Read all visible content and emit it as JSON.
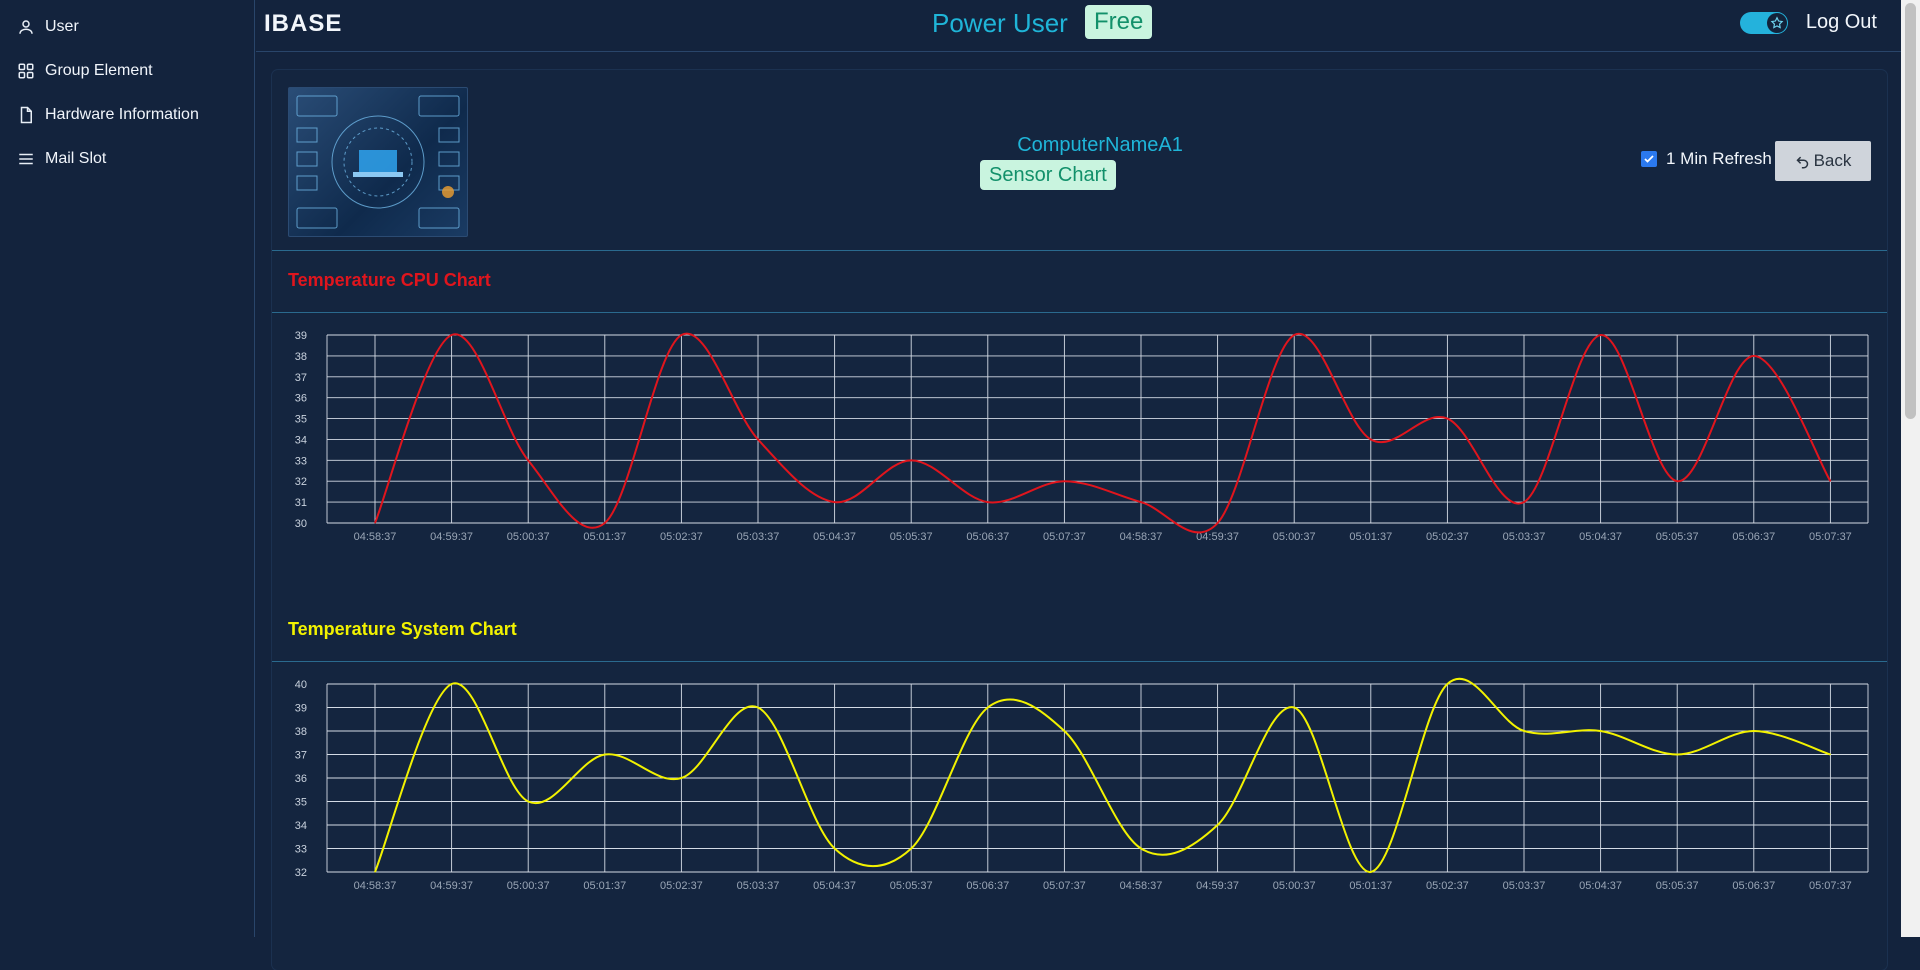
{
  "sidebar": {
    "items": [
      {
        "label": "User",
        "icon": "user-icon"
      },
      {
        "label": "Group Element",
        "icon": "grid-icon"
      },
      {
        "label": "Hardware Information",
        "icon": "document-icon"
      },
      {
        "label": "Mail Slot",
        "icon": "menu-icon"
      }
    ]
  },
  "header": {
    "brand": "IBASE",
    "role": "Power User",
    "plan_badge": "Free",
    "logout_label": "Log Out",
    "theme_toggle_on": true
  },
  "device": {
    "name": "ComputerNameA1",
    "view_badge": "Sensor Chart",
    "refresh_label": "1 Min Refresh",
    "refresh_checked": true,
    "back_label": "Back"
  },
  "colors": {
    "accent": "#1fb5d8",
    "badge_bg": "#c9f4df",
    "badge_text": "#12906a",
    "cpu_line": "#e0151d",
    "system_line": "#f2f200"
  },
  "chart_data": [
    {
      "type": "line",
      "title": "Temperature CPU Chart",
      "color": "#e0151d",
      "x": [
        "04:58:37",
        "04:59:37",
        "05:00:37",
        "05:01:37",
        "05:02:37",
        "05:03:37",
        "05:04:37",
        "05:05:37",
        "05:06:37",
        "05:07:37",
        "04:58:37",
        "04:59:37",
        "05:00:37",
        "05:01:37",
        "05:02:37",
        "05:03:37",
        "05:04:37",
        "05:05:37",
        "05:06:37",
        "05:07:37"
      ],
      "values": [
        30,
        39,
        33,
        30,
        39,
        34,
        31,
        33,
        31,
        32,
        31,
        30,
        39,
        34,
        35,
        31,
        39,
        32,
        38,
        32
      ],
      "ylim": [
        30,
        39
      ],
      "yticks": [
        30,
        31,
        32,
        33,
        34,
        35,
        36,
        37,
        38,
        39
      ],
      "grid": true
    },
    {
      "type": "line",
      "title": "Temperature System Chart",
      "color": "#f2f200",
      "x": [
        "04:58:37",
        "04:59:37",
        "05:00:37",
        "05:01:37",
        "05:02:37",
        "05:03:37",
        "05:04:37",
        "05:05:37",
        "05:06:37",
        "05:07:37",
        "04:58:37",
        "04:59:37",
        "05:00:37",
        "05:01:37",
        "05:02:37",
        "05:03:37",
        "05:04:37",
        "05:05:37",
        "05:06:37",
        "05:07:37"
      ],
      "values": [
        32,
        40,
        35,
        37,
        36,
        39,
        33,
        33,
        39,
        38,
        33,
        34,
        39,
        32,
        40,
        38,
        38,
        37,
        38,
        37
      ],
      "ylim": [
        32,
        40
      ],
      "yticks": [
        32,
        33,
        34,
        35,
        36,
        37,
        38,
        39,
        40
      ],
      "grid": true
    }
  ]
}
